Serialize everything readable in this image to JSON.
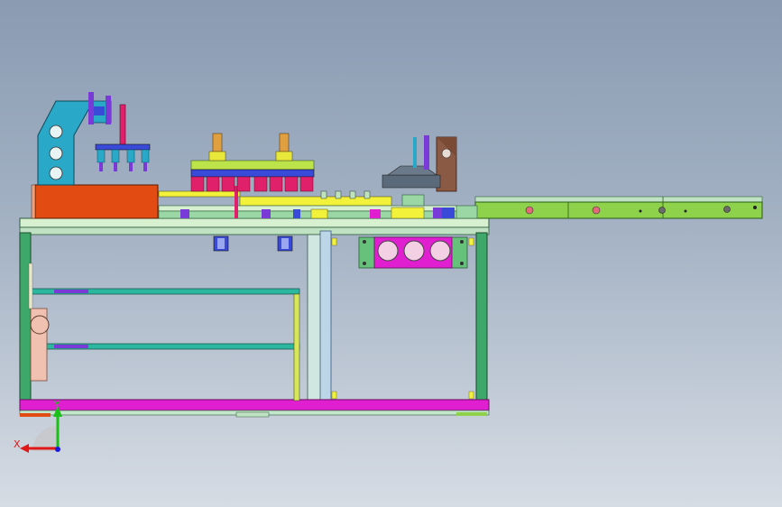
{
  "viewport": {
    "background_top": "#8a9bb2",
    "background_bottom": "#d6dce4"
  },
  "colors": {
    "frame_green": "#3da86a",
    "frame_light": "#bfe3c2",
    "beam_magenta": "#e020d0",
    "block_orange": "#e24c12",
    "bracket_cyan": "#2aa8c8",
    "conveyor_green": "#8ed14a",
    "rail_yellow": "#f2f23a",
    "plate_brown": "#8a5a44",
    "actuator_red": "#e0206a",
    "actuator_blue": "#3a4ad8",
    "shelf_teal": "#2cb8a0",
    "panel_pink": "#f0c0b0"
  },
  "triad": {
    "x_label": "X",
    "y_label": "Y",
    "x_axis_color": "#e01818",
    "y_axis_color": "#18c018",
    "z_axis_color": "#1818e0"
  }
}
